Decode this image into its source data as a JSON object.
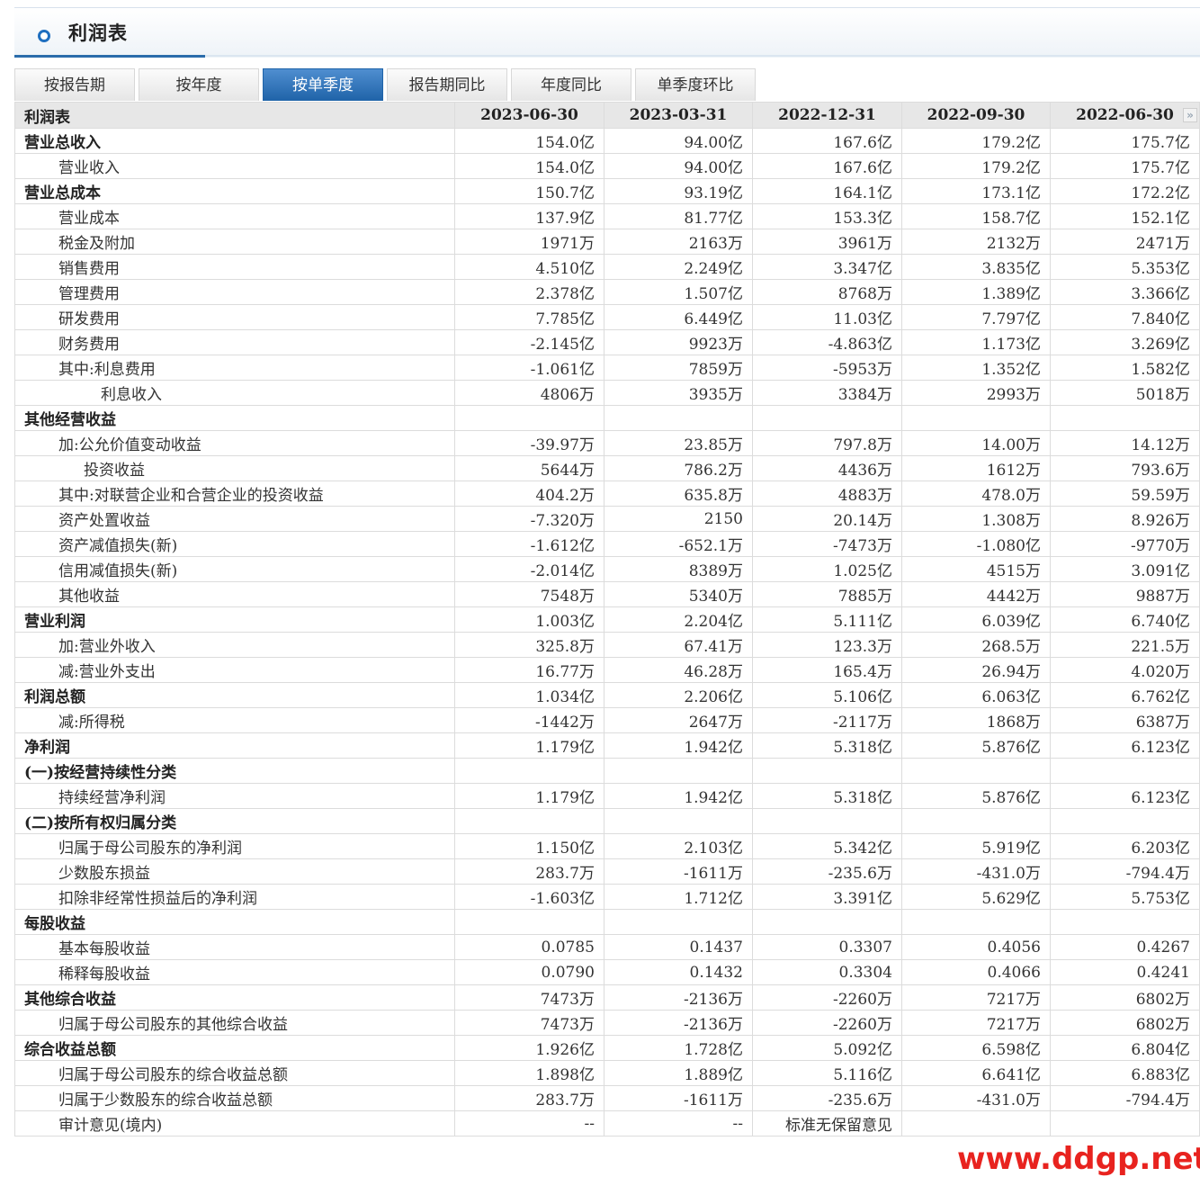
{
  "page_title": "利润表",
  "tabs": [
    "按报告期",
    "按年度",
    "按单季度",
    "报告期同比",
    "年度同比",
    "单季度环比"
  ],
  "active_tab": "按单季度",
  "table": {
    "header_label": "利润表",
    "columns": [
      "2023-06-30",
      "2023-03-31",
      "2022-12-31",
      "2022-09-30",
      "2022-06-30"
    ],
    "rows": [
      {
        "label": "营业总收入",
        "level": 0,
        "bold": true,
        "values": [
          "154.0亿",
          "94.00亿",
          "167.6亿",
          "179.2亿",
          "175.7亿"
        ]
      },
      {
        "label": "营业收入",
        "level": 1,
        "bold": false,
        "values": [
          "154.0亿",
          "94.00亿",
          "167.6亿",
          "179.2亿",
          "175.7亿"
        ]
      },
      {
        "label": "营业总成本",
        "level": 0,
        "bold": true,
        "values": [
          "150.7亿",
          "93.19亿",
          "164.1亿",
          "173.1亿",
          "172.2亿"
        ]
      },
      {
        "label": "营业成本",
        "level": 1,
        "bold": false,
        "values": [
          "137.9亿",
          "81.77亿",
          "153.3亿",
          "158.7亿",
          "152.1亿"
        ]
      },
      {
        "label": "税金及附加",
        "level": 1,
        "bold": false,
        "values": [
          "1971万",
          "2163万",
          "3961万",
          "2132万",
          "2471万"
        ]
      },
      {
        "label": "销售费用",
        "level": 1,
        "bold": false,
        "values": [
          "4.510亿",
          "2.249亿",
          "3.347亿",
          "3.835亿",
          "5.353亿"
        ]
      },
      {
        "label": "管理费用",
        "level": 1,
        "bold": false,
        "values": [
          "2.378亿",
          "1.507亿",
          "8768万",
          "1.389亿",
          "3.366亿"
        ]
      },
      {
        "label": "研发费用",
        "level": 1,
        "bold": false,
        "values": [
          "7.785亿",
          "6.449亿",
          "11.03亿",
          "7.797亿",
          "7.840亿"
        ]
      },
      {
        "label": "财务费用",
        "level": 1,
        "bold": false,
        "values": [
          "-2.145亿",
          "9923万",
          "-4.863亿",
          "1.173亿",
          "3.269亿"
        ]
      },
      {
        "label": "其中:利息费用",
        "level": 1,
        "bold": false,
        "values": [
          "-1.061亿",
          "7859万",
          "-5953万",
          "1.352亿",
          "1.582亿"
        ]
      },
      {
        "label": "利息收入",
        "level": 2,
        "bold": false,
        "values": [
          "4806万",
          "3935万",
          "3384万",
          "2993万",
          "5018万"
        ]
      },
      {
        "label": "其他经营收益",
        "level": 0,
        "bold": true,
        "values": [
          "",
          "",
          "",
          "",
          ""
        ]
      },
      {
        "label": "加:公允价值变动收益",
        "level": 1,
        "bold": false,
        "values": [
          "-39.97万",
          "23.85万",
          "797.8万",
          "14.00万",
          "14.12万"
        ]
      },
      {
        "label": "投资收益",
        "level": 3,
        "bold": false,
        "values": [
          "5644万",
          "786.2万",
          "4436万",
          "1612万",
          "793.6万"
        ]
      },
      {
        "label": "其中:对联营企业和合营企业的投资收益",
        "level": 1,
        "bold": false,
        "values": [
          "404.2万",
          "635.8万",
          "4883万",
          "478.0万",
          "59.59万"
        ]
      },
      {
        "label": "资产处置收益",
        "level": 1,
        "bold": false,
        "values": [
          "-7.320万",
          "2150",
          "20.14万",
          "1.308万",
          "8.926万"
        ]
      },
      {
        "label": "资产减值损失(新)",
        "level": 1,
        "bold": false,
        "values": [
          "-1.612亿",
          "-652.1万",
          "-7473万",
          "-1.080亿",
          "-9770万"
        ]
      },
      {
        "label": "信用减值损失(新)",
        "level": 1,
        "bold": false,
        "values": [
          "-2.014亿",
          "8389万",
          "1.025亿",
          "4515万",
          "3.091亿"
        ]
      },
      {
        "label": "其他收益",
        "level": 1,
        "bold": false,
        "values": [
          "7548万",
          "5340万",
          "7885万",
          "4442万",
          "9887万"
        ]
      },
      {
        "label": "营业利润",
        "level": 0,
        "bold": true,
        "values": [
          "1.003亿",
          "2.204亿",
          "5.111亿",
          "6.039亿",
          "6.740亿"
        ]
      },
      {
        "label": "加:营业外收入",
        "level": 1,
        "bold": false,
        "values": [
          "325.8万",
          "67.41万",
          "123.3万",
          "268.5万",
          "221.5万"
        ]
      },
      {
        "label": "减:营业外支出",
        "level": 1,
        "bold": false,
        "values": [
          "16.77万",
          "46.28万",
          "165.4万",
          "26.94万",
          "4.020万"
        ]
      },
      {
        "label": "利润总额",
        "level": 0,
        "bold": true,
        "values": [
          "1.034亿",
          "2.206亿",
          "5.106亿",
          "6.063亿",
          "6.762亿"
        ]
      },
      {
        "label": "减:所得税",
        "level": 1,
        "bold": false,
        "values": [
          "-1442万",
          "2647万",
          "-2117万",
          "1868万",
          "6387万"
        ]
      },
      {
        "label": "净利润",
        "level": 0,
        "bold": true,
        "values": [
          "1.179亿",
          "1.942亿",
          "5.318亿",
          "5.876亿",
          "6.123亿"
        ]
      },
      {
        "label": "(一)按经营持续性分类",
        "level": 0,
        "bold": true,
        "values": [
          "",
          "",
          "",
          "",
          ""
        ]
      },
      {
        "label": "持续经营净利润",
        "level": 1,
        "bold": false,
        "values": [
          "1.179亿",
          "1.942亿",
          "5.318亿",
          "5.876亿",
          "6.123亿"
        ]
      },
      {
        "label": "(二)按所有权归属分类",
        "level": 0,
        "bold": true,
        "values": [
          "",
          "",
          "",
          "",
          ""
        ]
      },
      {
        "label": "归属于母公司股东的净利润",
        "level": 1,
        "bold": false,
        "values": [
          "1.150亿",
          "2.103亿",
          "5.342亿",
          "5.919亿",
          "6.203亿"
        ]
      },
      {
        "label": "少数股东损益",
        "level": 1,
        "bold": false,
        "values": [
          "283.7万",
          "-1611万",
          "-235.6万",
          "-431.0万",
          "-794.4万"
        ]
      },
      {
        "label": "扣除非经常性损益后的净利润",
        "level": 1,
        "bold": false,
        "values": [
          "-1.603亿",
          "1.712亿",
          "3.391亿",
          "5.629亿",
          "5.753亿"
        ]
      },
      {
        "label": "每股收益",
        "level": 0,
        "bold": true,
        "values": [
          "",
          "",
          "",
          "",
          ""
        ]
      },
      {
        "label": "基本每股收益",
        "level": 1,
        "bold": false,
        "values": [
          "0.0785",
          "0.1437",
          "0.3307",
          "0.4056",
          "0.4267"
        ]
      },
      {
        "label": "稀释每股收益",
        "level": 1,
        "bold": false,
        "values": [
          "0.0790",
          "0.1432",
          "0.3304",
          "0.4066",
          "0.4241"
        ]
      },
      {
        "label": "其他综合收益",
        "level": 0,
        "bold": true,
        "values": [
          "7473万",
          "-2136万",
          "-2260万",
          "7217万",
          "6802万"
        ]
      },
      {
        "label": "归属于母公司股东的其他综合收益",
        "level": 1,
        "bold": false,
        "values": [
          "7473万",
          "-2136万",
          "-2260万",
          "7217万",
          "6802万"
        ]
      },
      {
        "label": "综合收益总额",
        "level": 0,
        "bold": true,
        "values": [
          "1.926亿",
          "1.728亿",
          "5.092亿",
          "6.598亿",
          "6.804亿"
        ]
      },
      {
        "label": "归属于母公司股东的综合收益总额",
        "level": 1,
        "bold": false,
        "values": [
          "1.898亿",
          "1.889亿",
          "5.116亿",
          "6.641亿",
          "6.883亿"
        ]
      },
      {
        "label": "归属于少数股东的综合收益总额",
        "level": 1,
        "bold": false,
        "values": [
          "283.7万",
          "-1611万",
          "-235.6万",
          "-431.0万",
          "-794.4万"
        ]
      },
      {
        "label": "审计意见(境内)",
        "level": 1,
        "bold": false,
        "values": [
          "--",
          "--",
          "标准无保留意见",
          "",
          ""
        ]
      }
    ]
  },
  "scroll_icon": "double-chevron-right-icon",
  "watermark": "www.ddgp.net",
  "colors": {
    "accent": "#1f63a8",
    "header_bg": "#e7e7e7",
    "watermark": "#e8231f"
  }
}
